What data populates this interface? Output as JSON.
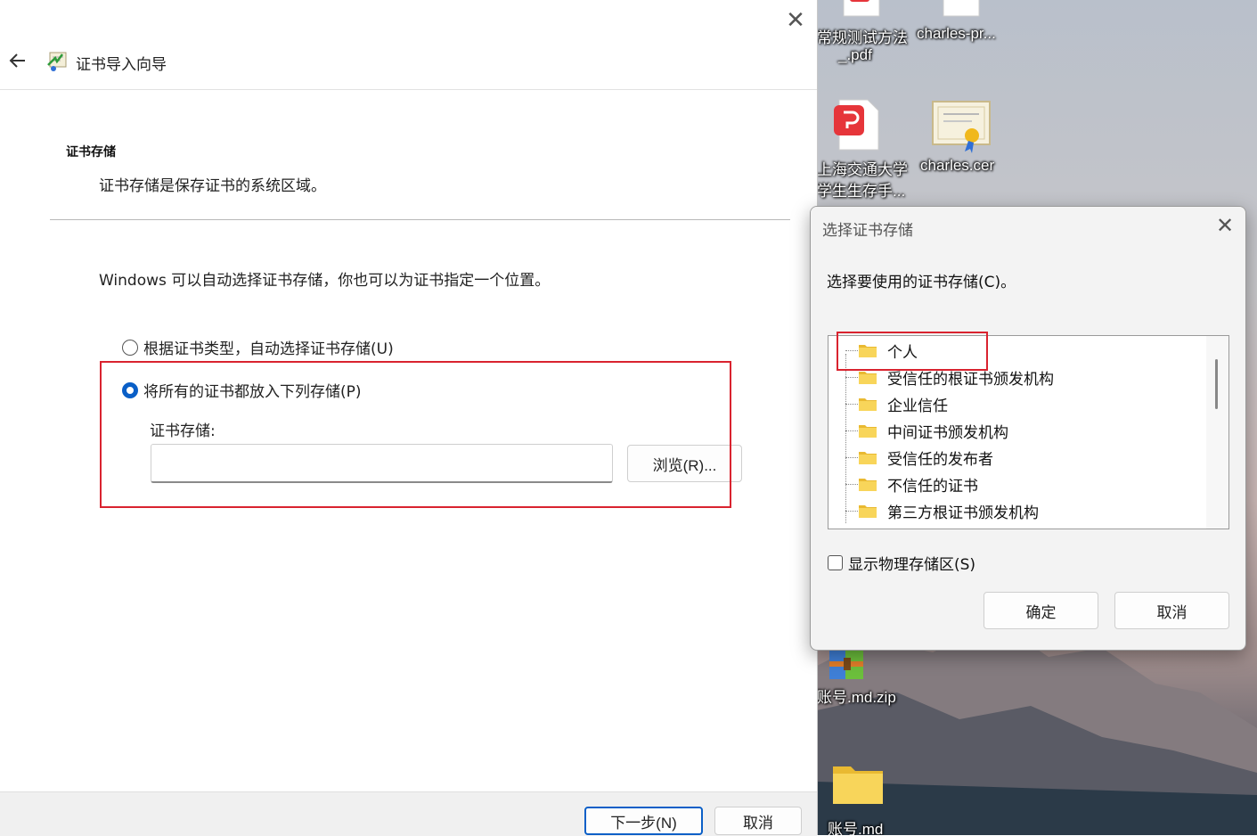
{
  "wizard": {
    "title": "证书导入向导",
    "section_title": "证书存储",
    "section_subtitle": "证书存储是保存证书的系统区域。",
    "intro": "Windows 可以自动选择证书存储，你也可以为证书指定一个位置。",
    "radio_auto": "根据证书类型，自动选择证书存储(U)",
    "radio_manual": "将所有的证书都放入下列存储(P)",
    "selected_option": "manual",
    "store_label": "证书存储:",
    "store_value": "",
    "browse_label": "浏览(R)...",
    "next_label": "下一步(N)",
    "cancel_label": "取消"
  },
  "dialog": {
    "title": "选择证书存储",
    "prompt": "选择要使用的证书存储(C)。",
    "stores": [
      "个人",
      "受信任的根证书颁发机构",
      "企业信任",
      "中间证书颁发机构",
      "受信任的发布者",
      "不信任的证书",
      "第三方根证书颁发机构"
    ],
    "show_physical": "显示物理存储区(S)",
    "ok_label": "确定",
    "cancel_label": "取消"
  },
  "desktop": {
    "icons": [
      {
        "label_line1": "常规测试方法",
        "label_line2": "_.pdf"
      },
      {
        "label_line1": "charles-pr...",
        "label_line2": ""
      },
      {
        "label_line1": "上海交通大学",
        "label_line2": "学生生存手..."
      },
      {
        "label_line1": "charles.cer",
        "label_line2": ""
      },
      {
        "label_line1": "账号.md.zip",
        "label_line2": ""
      },
      {
        "label_line1": "账号.md",
        "label_line2": ""
      }
    ]
  },
  "colors": {
    "accent": "#0a5fc7",
    "highlight_box": "#d9232f",
    "folder": "#f3c754"
  }
}
